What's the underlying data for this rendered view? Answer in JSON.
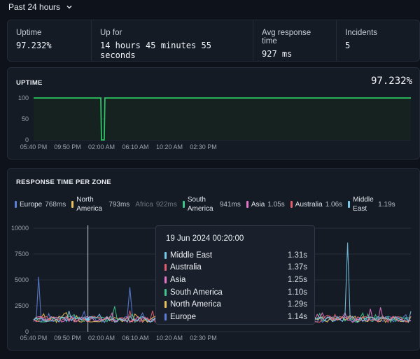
{
  "time_range": {
    "label": "Past 24 hours"
  },
  "stats": [
    {
      "label": "Uptime",
      "value": "97.232%"
    },
    {
      "label": "Up for",
      "value": "14 hours 45 minutes 55 seconds"
    },
    {
      "label": "Avg response time",
      "value": "927 ms"
    },
    {
      "label": "Incidents",
      "value": "5"
    }
  ],
  "uptime_panel": {
    "title": "UPTIME",
    "value": "97.232%",
    "line_color": "#2ec662"
  },
  "response_panel": {
    "title": "RESPONSE TIME PER ZONE",
    "legend": [
      {
        "name": "Europe",
        "value": "768ms",
        "color": "#5b7fd8",
        "active": true
      },
      {
        "name": "North America",
        "value": "793ms",
        "color": "#e8c15a",
        "active": true
      },
      {
        "name": "Africa",
        "value": "922ms",
        "color": "#7a828e",
        "active": false
      },
      {
        "name": "South America",
        "value": "941ms",
        "color": "#3fc48c",
        "active": true
      },
      {
        "name": "Asia",
        "value": "1.05s",
        "color": "#e277c9",
        "active": true
      },
      {
        "name": "Australia",
        "value": "1.06s",
        "color": "#e25d6e",
        "active": true
      },
      {
        "name": "Middle East",
        "value": "1.19s",
        "color": "#79c7e8",
        "active": true
      }
    ]
  },
  "tooltip": {
    "date": "19 Jun 2024 00:20:00",
    "rows": [
      {
        "name": "Middle East",
        "value": "1.31s",
        "color": "#79c7e8"
      },
      {
        "name": "Australia",
        "value": "1.37s",
        "color": "#e25d6e"
      },
      {
        "name": "Asia",
        "value": "1.25s",
        "color": "#e277c9"
      },
      {
        "name": "South America",
        "value": "1.10s",
        "color": "#3fc48c"
      },
      {
        "name": "North America",
        "value": "1.29s",
        "color": "#e8c15a"
      },
      {
        "name": "Europe",
        "value": "1.14s",
        "color": "#5b7fd8"
      }
    ]
  },
  "chart_data": [
    {
      "type": "line",
      "title": "UPTIME",
      "x_ticks": [
        "05:40 PM",
        "09:50 PM",
        "02:00 AM",
        "06:10 AM",
        "10:20 AM",
        "02:30 PM"
      ],
      "y_ticks": [
        0,
        50,
        100
      ],
      "ylim": [
        0,
        100
      ],
      "x": [
        "05:40 PM",
        "01:55 AM",
        "02:00 AM",
        "02:20 AM",
        "02:25 AM",
        "05:00 PM"
      ],
      "series": [
        {
          "values": [
            100,
            100,
            0,
            0,
            100,
            100
          ],
          "color": "#2ec662"
        }
      ]
    },
    {
      "type": "line",
      "title": "RESPONSE TIME PER ZONE",
      "x_ticks": [
        "05:40 PM",
        "09:50 PM",
        "02:00 AM",
        "06:10 AM",
        "10:20 AM",
        "02:30 PM"
      ],
      "y_ticks": [
        0,
        2500,
        5000,
        7500,
        10000
      ],
      "ylim": [
        0,
        10000
      ],
      "hover_x": "00:20 AM",
      "series": [
        {
          "name": "Europe",
          "color": "#5b7fd8",
          "spikes": [
            {
              "x": "05:55 PM",
              "y": 5300
            },
            {
              "x": "11:30 PM",
              "y": 4300
            }
          ]
        },
        {
          "name": "North America",
          "color": "#e8c15a",
          "spikes": []
        },
        {
          "name": "South America",
          "color": "#3fc48c",
          "spikes": [
            {
              "x": "10:40 PM",
              "y": 2450
            }
          ]
        },
        {
          "name": "Asia",
          "color": "#e277c9",
          "spikes": [
            {
              "x": "02:10 PM",
              "y": 2200
            },
            {
              "x": "02:50 PM",
              "y": 2350
            }
          ]
        },
        {
          "name": "Australia",
          "color": "#e25d6e",
          "spikes": []
        },
        {
          "name": "Middle East",
          "color": "#79c7e8",
          "spikes": [
            {
              "x": "12:50 PM",
              "y": 8600
            }
          ]
        }
      ]
    }
  ]
}
